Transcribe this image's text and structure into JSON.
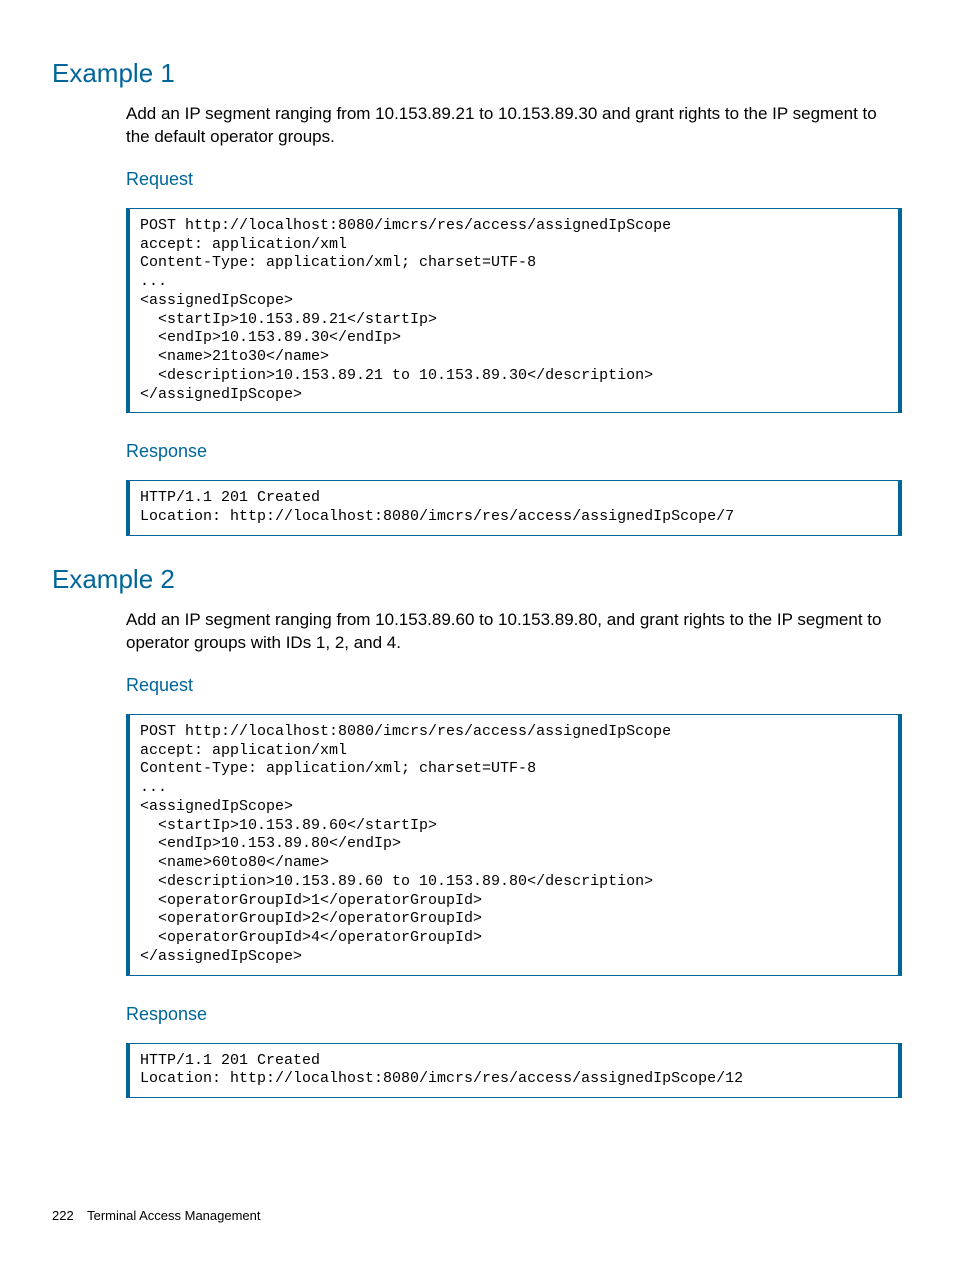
{
  "example1": {
    "title": "Example 1",
    "desc": "Add an IP segment ranging from 10.153.89.21 to 10.153.89.30 and grant rights to the IP segment to the default operator groups.",
    "request_label": "Request",
    "request_code": "POST http://localhost:8080/imcrs/res/access/assignedIpScope\naccept: application/xml\nContent-Type: application/xml; charset=UTF-8\n...\n<assignedIpScope>\n  <startIp>10.153.89.21</startIp>\n  <endIp>10.153.89.30</endIp>\n  <name>21to30</name>\n  <description>10.153.89.21 to 10.153.89.30</description>\n</assignedIpScope>",
    "response_label": "Response",
    "response_code": "HTTP/1.1 201 Created\nLocation: http://localhost:8080/imcrs/res/access/assignedIpScope/7"
  },
  "example2": {
    "title": "Example 2",
    "desc": "Add an IP segment ranging from 10.153.89.60 to 10.153.89.80, and grant rights to the IP segment to operator groups with IDs 1, 2, and 4.",
    "request_label": "Request",
    "request_code": "POST http://localhost:8080/imcrs/res/access/assignedIpScope\naccept: application/xml\nContent-Type: application/xml; charset=UTF-8\n...\n<assignedIpScope>\n  <startIp>10.153.89.60</startIp>\n  <endIp>10.153.89.80</endIp>\n  <name>60to80</name>\n  <description>10.153.89.60 to 10.153.89.80</description>\n  <operatorGroupId>1</operatorGroupId>\n  <operatorGroupId>2</operatorGroupId>\n  <operatorGroupId>4</operatorGroupId>\n</assignedIpScope>",
    "response_label": "Response",
    "response_code": "HTTP/1.1 201 Created\nLocation: http://localhost:8080/imcrs/res/access/assignedIpScope/12"
  },
  "footer": {
    "page": "222",
    "section": "Terminal Access Management"
  }
}
